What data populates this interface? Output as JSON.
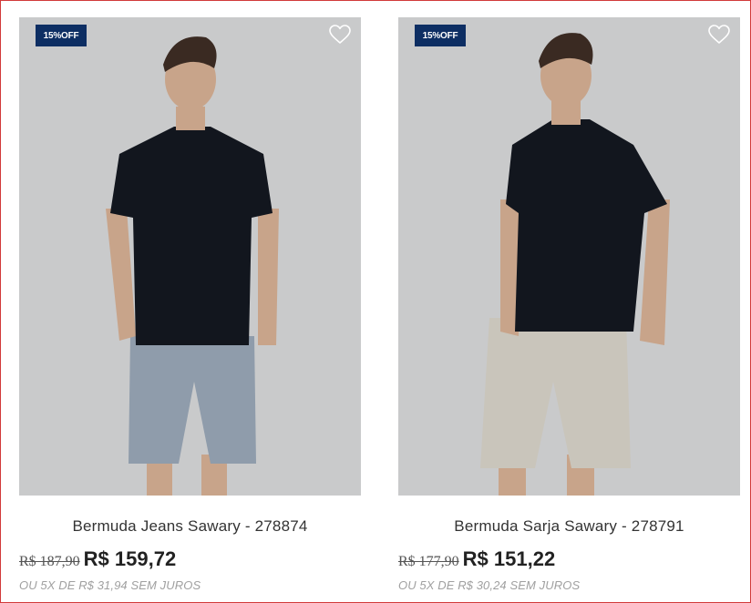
{
  "products": [
    {
      "badge": "15%OFF",
      "name": "Bermuda Jeans Sawary - 278874",
      "old_price": "R$ 187,90",
      "price": "R$ 159,72",
      "installments": "OU 5X DE R$ 31,94 SEM JUROS",
      "shorts_color": "#8f9cab",
      "shirt_color": "#12161e"
    },
    {
      "badge": "15%OFF",
      "name": "Bermuda Sarja Sawary - 278791",
      "old_price": "R$ 177,90",
      "price": "R$ 151,22",
      "installments": "OU 5X DE R$ 30,24 SEM JUROS",
      "shorts_color": "#c9c5bb",
      "shirt_color": "#12161e"
    }
  ],
  "icons": {
    "wishlist": "heart-outline-icon"
  },
  "colors": {
    "badge_bg": "#0d2e63",
    "photo_bg": "#c9cacb",
    "border": "#d23a3a"
  }
}
